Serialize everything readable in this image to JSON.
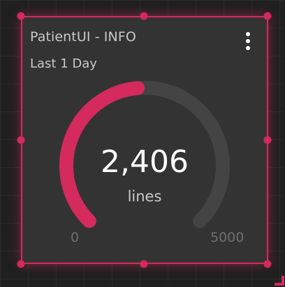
{
  "widget": {
    "title": "PatientUI - INFO",
    "subtitle": "Last 1 Day",
    "menu_icon": "more-vertical-icon"
  },
  "gauge": {
    "value": 2406,
    "value_label": "2,406",
    "unit": "lines",
    "min_label": "0",
    "max_label": "5000",
    "min": 0,
    "max": 5000
  },
  "colors": {
    "accent": "#d42a5e",
    "panel": "#333333",
    "track": "#444444",
    "background": "#202020"
  }
}
